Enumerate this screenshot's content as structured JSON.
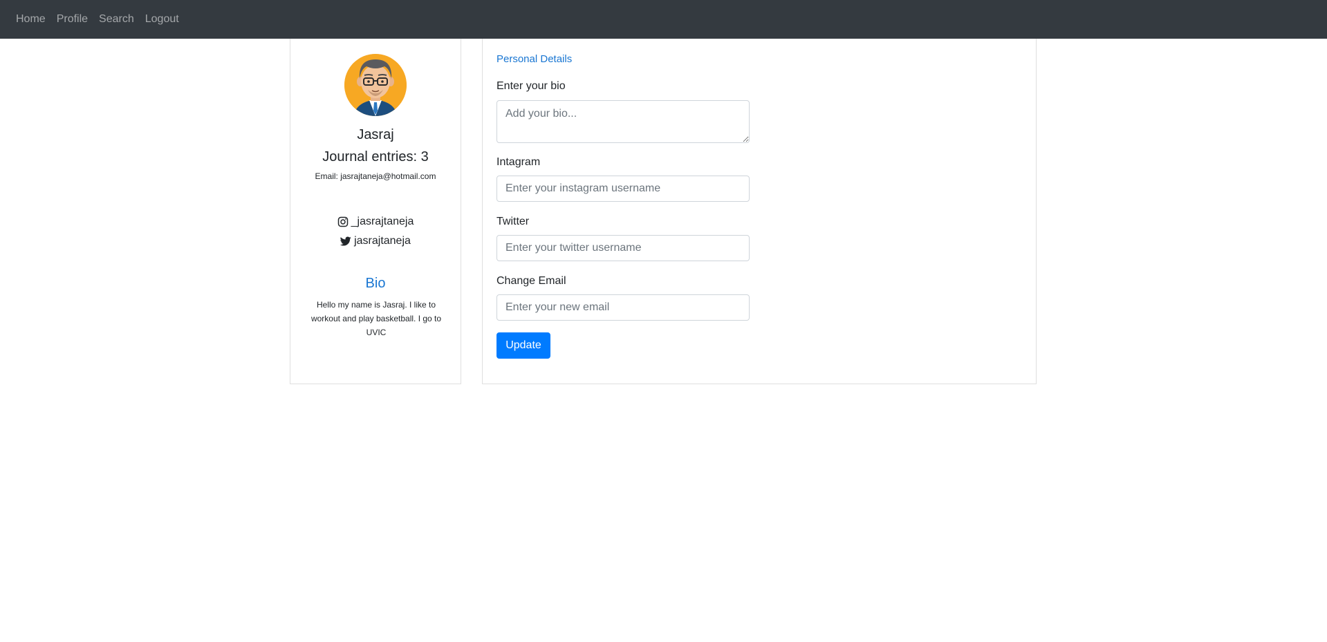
{
  "nav": {
    "items": [
      {
        "label": "Home"
      },
      {
        "label": "Profile"
      },
      {
        "label": "Search"
      },
      {
        "label": "Logout"
      }
    ]
  },
  "profile": {
    "name": "Jasraj",
    "entries_text": "Journal entries: 3",
    "email_text": "Email: jasrajtaneja@hotmail.com",
    "instagram": "_jasrajtaneja",
    "twitter": "jasrajtaneja",
    "bio_heading": "Bio",
    "bio_text": "Hello my name is Jasraj. I like to workout and play basketball. I go to UVIC"
  },
  "form": {
    "section_title": "Personal Details",
    "bio_label": "Enter your bio",
    "bio_placeholder": "Add your bio...",
    "instagram_label": "Intagram",
    "instagram_placeholder": "Enter your instagram username",
    "twitter_label": "Twitter",
    "twitter_placeholder": "Enter your twitter username",
    "email_label": "Change Email",
    "email_placeholder": "Enter your new email",
    "update_label": "Update"
  },
  "colors": {
    "navbar": "#343a40",
    "accent": "#1976d2",
    "primary_button": "#007bff"
  },
  "icons": {
    "instagram": "instagram-icon",
    "twitter": "twitter-icon",
    "avatar": "avatar-illustration"
  }
}
